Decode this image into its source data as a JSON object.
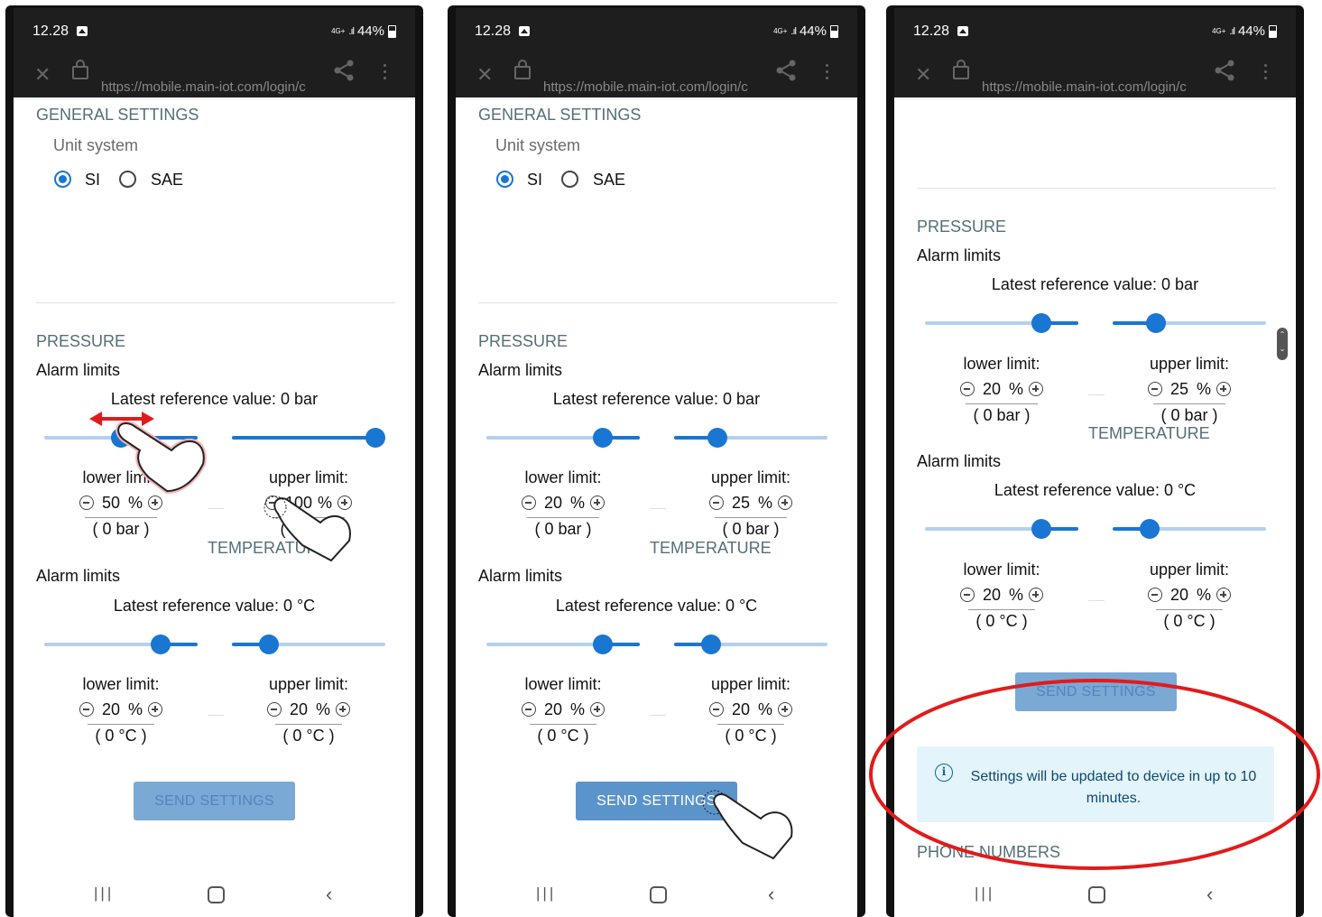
{
  "status": {
    "time": "12.28",
    "network": "4G+",
    "battery": "44%"
  },
  "browser": {
    "url": "https://mobile.main-iot.com/login/c"
  },
  "general": {
    "title": "GENERAL SETTINGS",
    "unit_label": "Unit system",
    "options": [
      "SI",
      "SAE"
    ],
    "selected": "SI"
  },
  "pressure": {
    "title": "PRESSURE"
  },
  "temperature": {
    "title": "TEMPERATURE"
  },
  "alarm_label": "Alarm limits",
  "ref_pressure": "Latest reference value: 0 bar",
  "ref_temperature": "Latest reference value: 0 °C",
  "lower_label": "lower limit:",
  "upper_label": "upper limit:",
  "unit_pct": "%",
  "conv_bar": "( 0 bar )",
  "conv_c": "( 0 °C )",
  "send_button": "SEND SETTINGS",
  "info_message": "Settings will be updated to device in up to 10 minutes.",
  "phone_numbers": "PHONE NUMBERS",
  "screens": [
    {
      "pressure_lower": "50",
      "pressure_upper": "100",
      "temp_lower": "20",
      "temp_upper": "20",
      "pressure_lower_pos": 0.5,
      "pressure_upper_pos": 1.0,
      "temp_lower_pos": 0.8,
      "temp_upper_pos": 0.2,
      "button_state": "disabled"
    },
    {
      "pressure_lower": "20",
      "pressure_upper": "25",
      "temp_lower": "20",
      "temp_upper": "20",
      "pressure_lower_pos": 0.8,
      "pressure_upper_pos": 0.25,
      "temp_lower_pos": 0.8,
      "temp_upper_pos": 0.2,
      "button_state": "enabled"
    },
    {
      "pressure_lower": "20",
      "pressure_upper": "25",
      "temp_lower": "20",
      "temp_upper": "20",
      "pressure_lower_pos": 0.8,
      "pressure_upper_pos": 0.25,
      "temp_lower_pos": 0.8,
      "temp_upper_pos": 0.2,
      "button_state": "disabled"
    }
  ],
  "colors": {
    "accent": "#1976d2",
    "annotation": "#e11b1b",
    "button": "#5b93cb"
  },
  "annotations": [
    "double-arrow-icon",
    "hand-pointer-icon",
    "highlight-ellipse"
  ]
}
